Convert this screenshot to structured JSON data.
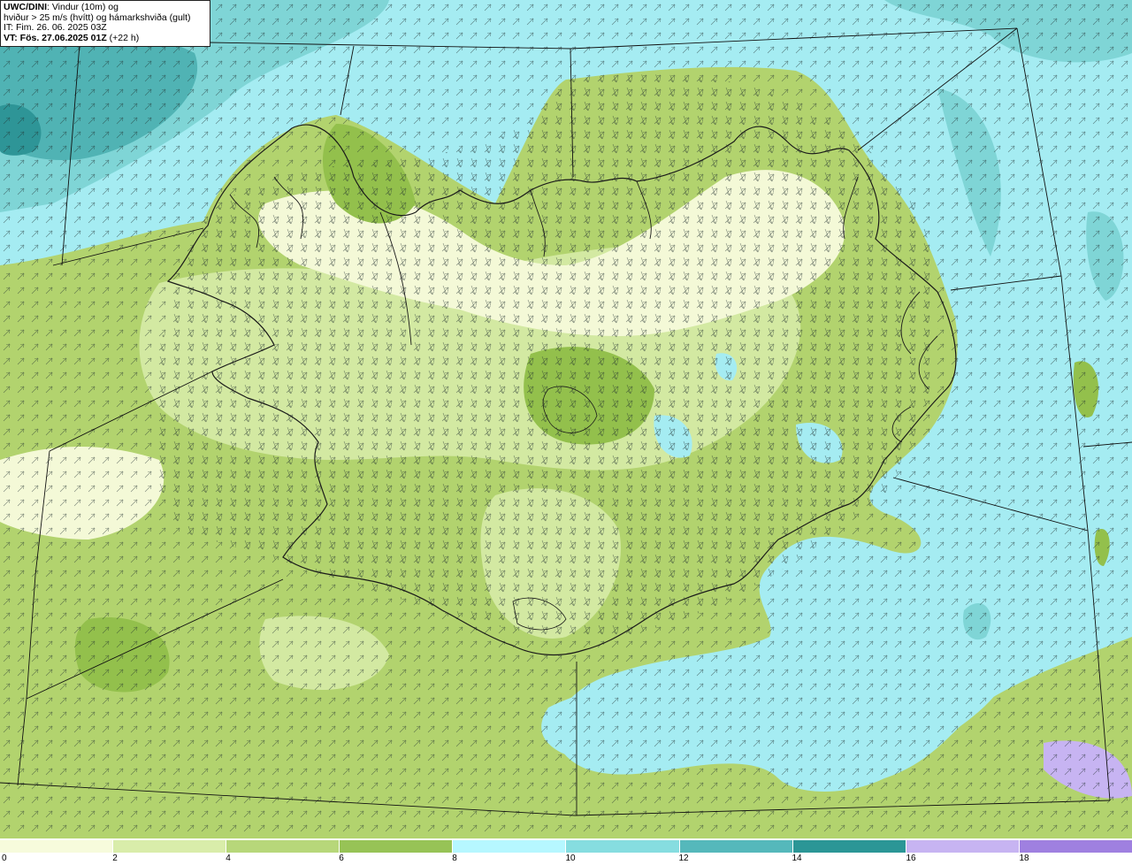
{
  "info": {
    "title_bold": "UWC/DINI",
    "title_rest": ": Vindur (10m) og",
    "line2": "hviður > 25 m/s (hvítt) og hámarkshviða (gult)",
    "line3": "IT: Fim. 26. 06. 2025 03Z",
    "line4_bold": "VT: Fös. 27.06.2025 01Z",
    "line4_rest": " (+22 h)"
  },
  "colorbar": {
    "ticks": [
      "0",
      "2",
      "4",
      "6",
      "8",
      "10",
      "12",
      "14",
      "16",
      "18"
    ],
    "colors": [
      "#f7fbdc",
      "#d9edaa",
      "#b7d77a",
      "#97c356",
      "#b6f7ff",
      "#86dde0",
      "#55b8bb",
      "#2b9696",
      "#c7b4f2",
      "#9f80e0"
    ]
  },
  "map": {
    "sea_colors": [
      "#a5ecf2",
      "#7fd5d6",
      "#50b3b4",
      "#2e9597"
    ],
    "land_colors": [
      "#f4f9d7",
      "#d3e9a2",
      "#b2d36e",
      "#93c04c"
    ],
    "coast_color": "#1a1a1a"
  }
}
